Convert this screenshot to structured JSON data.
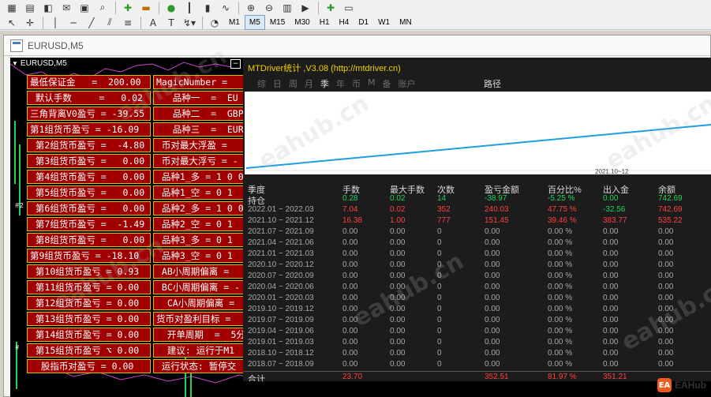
{
  "toolbar": {
    "timeframes": [
      "M1",
      "M5",
      "M15",
      "M30",
      "H1",
      "H4",
      "D1",
      "W1",
      "MN"
    ],
    "active_timeframe": "M5"
  },
  "window": {
    "title": "EURUSD,M5"
  },
  "chart": {
    "label": "EURUSD,M5",
    "tags": [
      "#2",
      "#"
    ]
  },
  "panel": {
    "left": [
      "最低保证金   =  200.00",
      " 默认手数     =   0.02",
      "三角背离V0盈亏 = -39.55",
      "第1组货币盈亏 = -16.09",
      " 第2组货币盈亏 =  -4.80",
      " 第3组货币盈亏 =   0.00",
      " 第4组货币盈亏 =   0.00",
      " 第5组货币盈亏 =   0.00",
      " 第6组货币盈亏 =   0.00",
      " 第7组货币盈亏 =  -1.49",
      " 第8组货币盈亏 =   0.00",
      "第9组货币盈亏 = -18.10",
      " 第10组货币盈亏 = 0.93",
      " 第11组货币盈亏 = 0.00",
      " 第12组货币盈亏 = 0.00",
      " 第13组货币盈亏 = 0.00",
      " 第14组货币盈亏 = 0.00",
      " 第15组货币盈亏 ⌥ 0.00",
      "  股指币对盈亏 = 0.00"
    ],
    "right": [
      "MagicNumber =",
      "   品种一  =  EU",
      "   品种二  =  GBP",
      "   品种三  =  EUR",
      " 币对最大浮盈 = ",
      " 币对最大浮亏 = -",
      " 品种1_多 = 1 0 0",
      " 品种1_空 = 0 1 ",
      " 品种2_多 = 1 0 0",
      " 品种2_空 = 0 1 ",
      " 品种3_多 = 0 1 ",
      " 品种3_空 = 0 1 ",
      " AB小周期偏离 = ",
      " BC小周期偏离 = -",
      "  CA小周期偏离 = ",
      "货币对盈利目标 = ",
      "  开单周期  =  5分",
      "  建议: 运行于M1",
      " 运行状态: 暂停交"
    ]
  },
  "stats": {
    "title": "MTDriver统计 ,V3.08 (http://mtdriver.cn)",
    "tabs": [
      "综",
      "日",
      "周",
      "月",
      "季",
      "年",
      "币",
      "M",
      "备",
      "账户"
    ],
    "active_tab": "季",
    "path_tab": "路径",
    "equity_date_label": "2021.10~12",
    "headers": [
      "季度",
      "手数",
      "最大手数",
      "次数",
      "盈亏金额",
      "百分比%",
      "出入金",
      "余额"
    ],
    "holding": [
      "持仓",
      "0.28",
      "0.02",
      "14",
      "-38.97",
      "-5.25 %",
      "0.00",
      "742.69"
    ],
    "rows": [
      [
        "2022.01 ~ 2022.03",
        "7.04",
        "0.02",
        "352",
        "240.03",
        "47.75 %",
        "-32.56",
        "742.69"
      ],
      [
        "2021.10 ~ 2021.12",
        "16.38",
        "1.00",
        "777",
        "151.45",
        "39.46 %",
        "383.77",
        "535.22"
      ],
      [
        "2021.07 ~ 2021.09",
        "0.00",
        "0.00",
        "0",
        "0.00",
        "0.00 %",
        "0.00",
        "0.00"
      ],
      [
        "2021.04 ~ 2021.06",
        "0.00",
        "0.00",
        "0",
        "0.00",
        "0.00 %",
        "0.00",
        "0.00"
      ],
      [
        "2021.01 ~ 2021.03",
        "0.00",
        "0.00",
        "0",
        "0.00",
        "0.00 %",
        "0.00",
        "0.00"
      ],
      [
        "2020.10 ~ 2020.12",
        "0.00",
        "0.00",
        "0",
        "0.00",
        "0.00 %",
        "0.00",
        "0.00"
      ],
      [
        "2020.07 ~ 2020.09",
        "0.00",
        "0.00",
        "0",
        "0.00",
        "0.00 %",
        "0.00",
        "0.00"
      ],
      [
        "2020.04 ~ 2020.06",
        "0.00",
        "0.00",
        "0",
        "0.00",
        "0.00 %",
        "0.00",
        "0.00"
      ],
      [
        "2020.01 ~ 2020.03",
        "0.00",
        "0.00",
        "0",
        "0.00",
        "0.00 %",
        "0.00",
        "0.00"
      ],
      [
        "2019.10 ~ 2019.12",
        "0.00",
        "0.00",
        "0",
        "0.00",
        "0.00 %",
        "0.00",
        "0.00"
      ],
      [
        "2019.07 ~ 2019.09",
        "0.00",
        "0.00",
        "0",
        "0.00",
        "0.00 %",
        "0.00",
        "0.00"
      ],
      [
        "2019.04 ~ 2019.06",
        "0.00",
        "0.00",
        "0",
        "0.00",
        "0.00 %",
        "0.00",
        "0.00"
      ],
      [
        "2019.01 ~ 2019.03",
        "0.00",
        "0.00",
        "0",
        "0.00",
        "0.00 %",
        "0.00",
        "0.00"
      ],
      [
        "2018.10 ~ 2018.12",
        "0.00",
        "0.00",
        "0",
        "0.00",
        "0.00 %",
        "0.00",
        "0.00"
      ],
      [
        "2018.07 ~ 2018.09",
        "0.00",
        "0.00",
        "0",
        "0.00",
        "0.00 %",
        "0.00",
        "0.00"
      ]
    ],
    "total": [
      "合计",
      "23.70",
      "",
      "",
      "352.51",
      "81.97 %",
      "351.21",
      ""
    ]
  },
  "colors": {
    "header": "#d8d8d8",
    "holding": "#22d35a",
    "red_row": "#ff4040",
    "dim_row": "#a8a8a8",
    "total": "#ff4040",
    "equity_line": "#1e9fe0"
  },
  "watermarks": [
    "eahub.cn",
    "eahub.cn",
    "eahub.cn",
    "eahub.cn",
    "eahub.cn",
    "eahub.cn"
  ],
  "logo": {
    "mark": "EA",
    "text": "EAHub"
  }
}
